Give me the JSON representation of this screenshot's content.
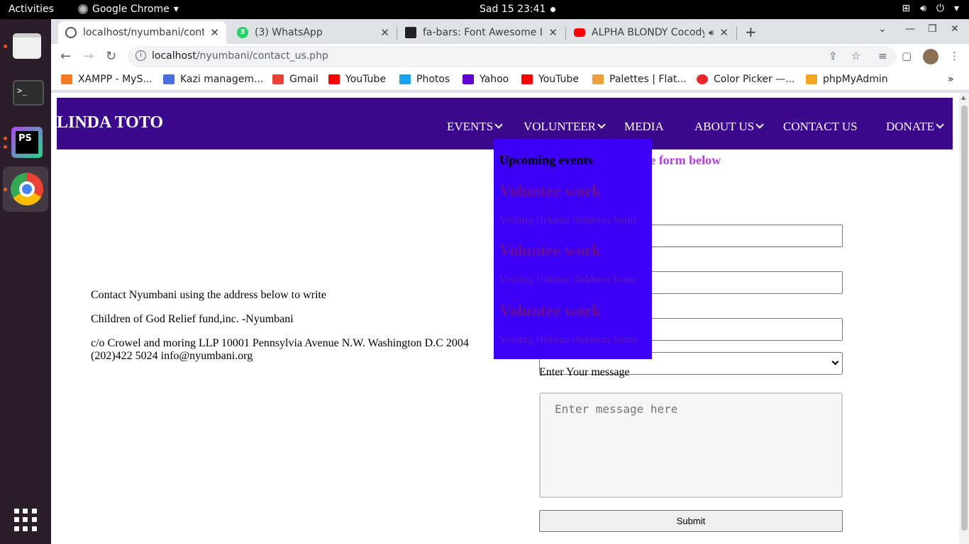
{
  "system": {
    "activities": "Activities",
    "app_name": "Google Chrome",
    "clock": "Sad 15  23:41"
  },
  "tabs": [
    {
      "title": "localhost/nyumbani/contact_us.php",
      "icon": "globe-icon"
    },
    {
      "title": "(3) WhatsApp",
      "icon": "whatsapp-icon"
    },
    {
      "title": "fa-bars: Font Awesome Icons",
      "icon": "flag-icon"
    },
    {
      "title": "ALPHA BLONDY Cocody Rock",
      "icon": "youtube-icon"
    }
  ],
  "omnibox": {
    "host": "localhost",
    "path": "/nyumbani/contact_us.php"
  },
  "bookmarks": [
    {
      "label": "XAMPP - MyS...",
      "color": "#fb7a24"
    },
    {
      "label": "Kazi managem...",
      "color": "#4a6ee0"
    },
    {
      "label": "Gmail",
      "color": "#ea4335"
    },
    {
      "label": "YouTube",
      "color": "#ff0000"
    },
    {
      "label": "Photos",
      "color": "#1da1f2"
    },
    {
      "label": "Yahoo",
      "color": "#6001d2"
    },
    {
      "label": "YouTube",
      "color": "#ff0000"
    },
    {
      "label": "Palettes | Flat...",
      "color": "#e9a23b"
    },
    {
      "label": "Color Picker —...",
      "color": "#e8262b"
    },
    {
      "label": "phpMyAdmin",
      "color": "#f5a623"
    }
  ],
  "site": {
    "logo": "LINDA TOTO",
    "nav": [
      {
        "label": "EVENTS",
        "has_dropdown": true
      },
      {
        "label": "VOLUNTEER",
        "has_dropdown": true
      },
      {
        "label": "MEDIA",
        "has_dropdown": false
      },
      {
        "label": "ABOUT US",
        "has_dropdown": true
      },
      {
        "label": "CONTACT US",
        "has_dropdown": false
      },
      {
        "label": "DONATE",
        "has_dropdown": true
      }
    ],
    "dropdown": {
      "heading": "Upcoming events",
      "items": [
        {
          "title": "Voluntee work",
          "subtitle": "Visiting Hekima childrens home"
        },
        {
          "title": "Voluntee work",
          "subtitle": "Visiting Hekima childrens home"
        },
        {
          "title": "Voluntee work",
          "subtitle": "Visiting Hekima childrens home"
        }
      ]
    },
    "contact_heading": "ontact us through the form below",
    "address": [
      "Contact Nyumbani using the address below to write",
      "Children of God Relief fund,inc. -Nyumbani",
      "c/o Crowel and moring LLP 10001 Pennsylvia Avenue N.W. Washington D.C 2004 (202)422 5024 info@nyumbani.org"
    ],
    "form": {
      "message_label": "Enter Your message",
      "message_placeholder": "Enter message here",
      "submit_label": "Submit"
    }
  },
  "colors": {
    "nav_bg": "#3b0a8c",
    "dropdown_bg": "#3b00f5",
    "heading_accent": "#b040e0"
  }
}
